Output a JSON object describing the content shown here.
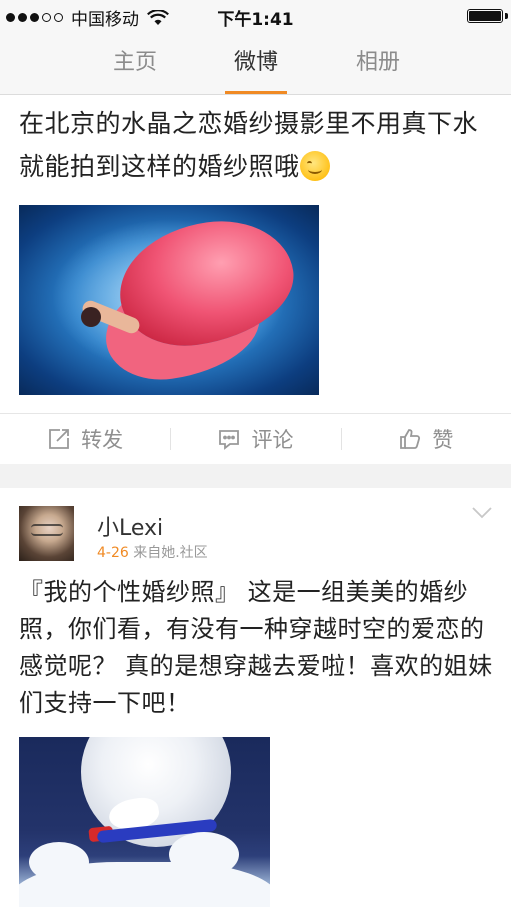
{
  "status_bar": {
    "carrier": "中国移动",
    "time": "下午1:41"
  },
  "tabs": [
    {
      "label": "主页",
      "active": false
    },
    {
      "label": "微博",
      "active": true
    },
    {
      "label": "相册",
      "active": false
    }
  ],
  "colors": {
    "accent": "#f08a24",
    "text": "#222222",
    "muted": "#8f8f8f"
  },
  "posts": [
    {
      "text": "在北京的水晶之恋婚纱摄影里不用真下水就能拍到这样的婚纱照哦",
      "emoji": "smiling-face-emoji",
      "image": "underwater-wedding-photo",
      "actions": {
        "repost": "转发",
        "comment": "评论",
        "like": "赞"
      }
    },
    {
      "username": "小Lexi",
      "date": "4-26",
      "source": "来自她.社区",
      "text": "『我的个性婚纱照』 这是一组美美的婚纱照，你们看，有没有一种穿越时空的爱恋的感觉呢？ 真的是想穿越去爱啦！喜欢的姐妹们支持一下吧！",
      "image": "moon-wedding-photo"
    }
  ]
}
